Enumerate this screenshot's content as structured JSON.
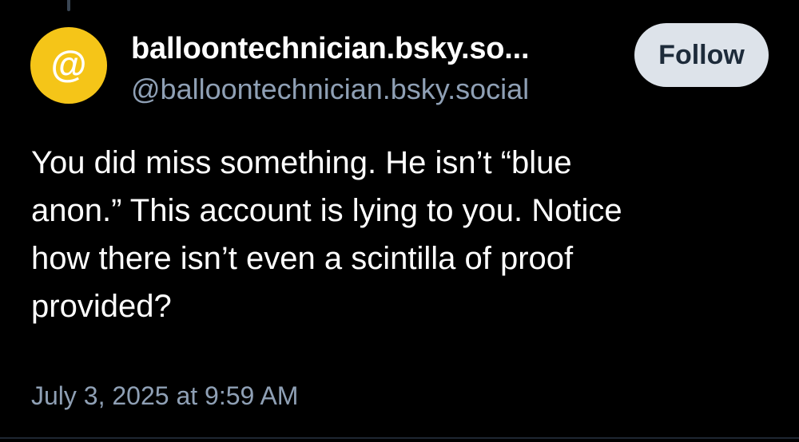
{
  "author": {
    "display_name": "balloontechnician.bsky.so...",
    "handle": "@balloontechnician.bsky.social",
    "avatar_glyph": "@",
    "avatar_color": "#f5c518"
  },
  "follow_button": {
    "label": "Follow"
  },
  "post": {
    "text": "You did miss something. He isn’t “blue\nanon.” This account is lying to you. Notice\nhow there isn’t even a scintilla of proof\nprovided?",
    "timestamp": "July 3, 2025 at 9:59 AM"
  },
  "colors": {
    "background": "#000000",
    "text_primary": "#ffffff",
    "text_secondary": "#8fa0b5",
    "button_background": "#dde3ea",
    "button_text": "#1d2b3a"
  }
}
